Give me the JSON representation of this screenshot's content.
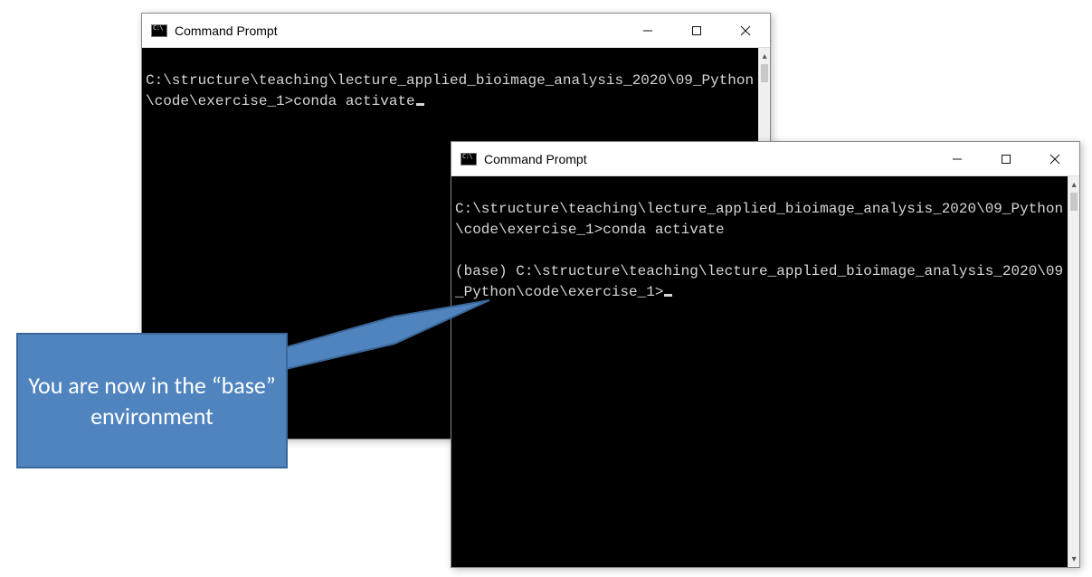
{
  "callout": {
    "text": "You are now in the “base” environment"
  },
  "window1": {
    "title": "Command Prompt",
    "lines": {
      "l0": "",
      "l1": "C:\\structure\\teaching\\lecture_applied_bioimage_analysis_2020\\09_Python\\code\\exercise_1>conda activate"
    }
  },
  "window2": {
    "title": "Command Prompt",
    "lines": {
      "l0": "",
      "l1": "C:\\structure\\teaching\\lecture_applied_bioimage_analysis_2020\\09_Python\\code\\exercise_1>conda activate",
      "l2": "",
      "l3": "(base) C:\\structure\\teaching\\lecture_applied_bioimage_analysis_2020\\09_Python\\code\\exercise_1>"
    }
  }
}
